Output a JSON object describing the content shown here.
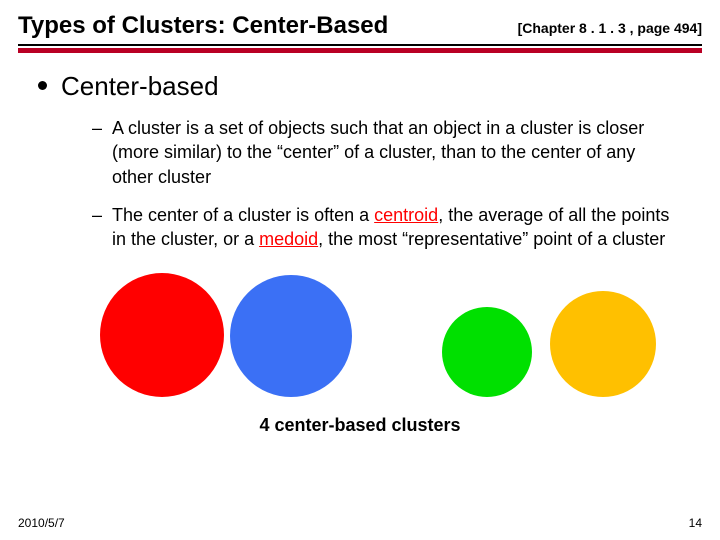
{
  "header": {
    "title": "Types of Clusters: Center-Based",
    "chapter_ref": "[Chapter 8 . 1 . 3 , page 494]"
  },
  "main": {
    "heading": "Center-based",
    "items": [
      {
        "pre": " A cluster is a set of objects such that an object in a cluster is closer (more similar) to the “center” of a cluster, than to the center of any other cluster"
      },
      {
        "pre": "The center of a cluster is often a ",
        "kw1": "centroid",
        "mid1": ", the average of all the points in the cluster, or a ",
        "kw2": "medoid",
        "mid2": ", the most “representative” point of a cluster"
      }
    ],
    "caption": "4 center-based clusters"
  },
  "clusters": [
    {
      "name": "red-cluster",
      "color": "#ff0000"
    },
    {
      "name": "blue-cluster",
      "color": "#3b70f5"
    },
    {
      "name": "green-cluster",
      "color": "#00e000"
    },
    {
      "name": "yellow-cluster",
      "color": "#ffc000"
    }
  ],
  "footer": {
    "date": "2010/5/7",
    "page": "14"
  }
}
